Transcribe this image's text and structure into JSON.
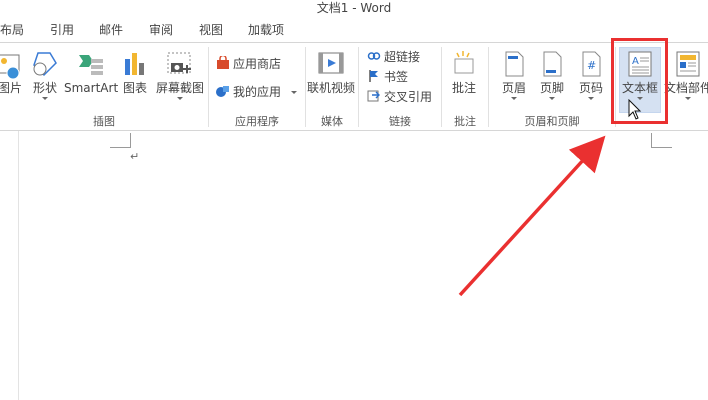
{
  "window": {
    "title": "文档1 - Word"
  },
  "tabs": [
    {
      "label": "布局"
    },
    {
      "label": "引用"
    },
    {
      "label": "邮件"
    },
    {
      "label": "审阅"
    },
    {
      "label": "视图"
    },
    {
      "label": "加载项"
    }
  ],
  "ribbon": {
    "illustrations": {
      "picture": "图片",
      "shapes": "形状",
      "smartart": "SmartArt",
      "chart": "图表",
      "screenshot": "屏幕截图",
      "group": "插图"
    },
    "apps": {
      "store": "应用商店",
      "myapps": "我的应用",
      "group": "应用程序"
    },
    "media": {
      "online_video": "联机视频",
      "group": "媒体"
    },
    "links": {
      "hyperlink": "超链接",
      "bookmark": "书签",
      "crossref": "交叉引用",
      "group": "链接"
    },
    "comments": {
      "comment": "批注",
      "group": "批注"
    },
    "header_footer": {
      "header": "页眉",
      "footer": "页脚",
      "page_number": "页码",
      "group": "页眉和页脚"
    },
    "text": {
      "textbox": "文本框",
      "quickparts": "文档部件"
    }
  },
  "colors": {
    "highlight": "#ea3030",
    "selected_bg": "#d5e1f2",
    "accent_blue": "#2b579a"
  }
}
